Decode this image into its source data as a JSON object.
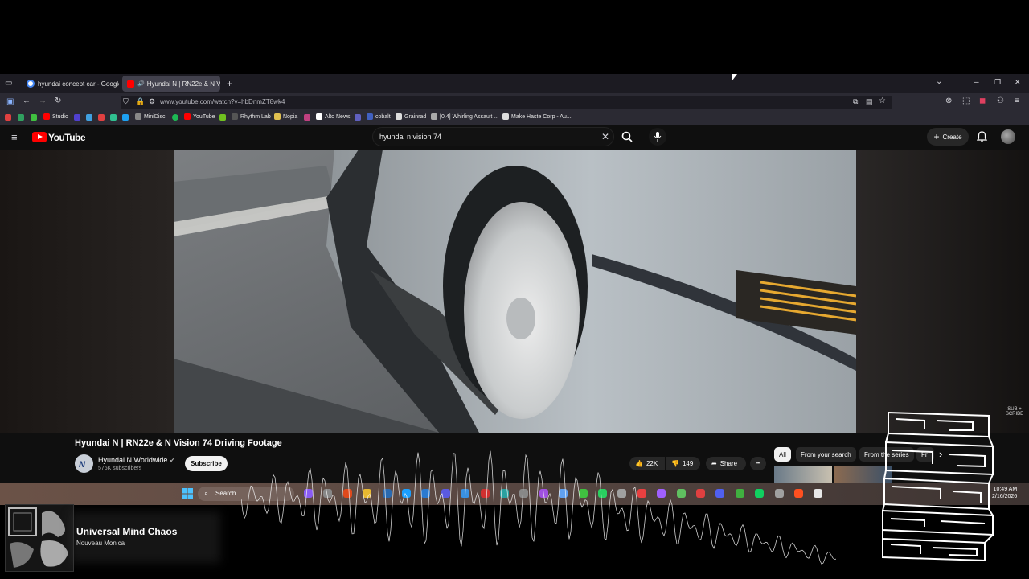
{
  "browser": {
    "tabs": [
      {
        "title": "hyundai concept car - Google S",
        "favicon_color": "#4285f4",
        "active": false
      },
      {
        "title": "Hyundai N | RN22e & N Vi",
        "favicon_color": "#ff0000",
        "active": true
      }
    ],
    "url": "www.youtube.com/watch?v=hbDnmZT8wk4",
    "bookmarks": [
      {
        "label": "Studio",
        "color": "#ff0000"
      },
      {
        "label": "MiniDisc",
        "color": "#888888"
      },
      {
        "label": "YouTube",
        "color": "#ff0000"
      },
      {
        "label": "Rhythm Lab",
        "color": "#555555"
      },
      {
        "label": "Nopia",
        "color": "#e0c050"
      },
      {
        "label": "Alto News",
        "color": "#ffffff"
      },
      {
        "label": "cobalt",
        "color": "#4060c0"
      },
      {
        "label": "Grainrad",
        "color": "#dddddd"
      },
      {
        "label": "[0.4] Whirling Assault ...",
        "color": "#aaaaaa"
      },
      {
        "label": "Make Haste Corp - Au...",
        "color": "#dddddd"
      }
    ],
    "icons": {
      "back": "←",
      "forward": "→",
      "reload": "↻",
      "new_tab": "+",
      "tab_list": "⌄",
      "minimize": "–",
      "maximize": "❐",
      "close": "✕",
      "tab_close": "✕"
    }
  },
  "youtube": {
    "logo_text": "YouTube",
    "search_query": "hyundai n vision 74",
    "create_label": "Create",
    "video_title": "Hyundai N | RN22e & N Vision 74 Driving Footage",
    "channel_name": "Hyundai N Worldwide",
    "subscribers": "576K subscribers",
    "subscribe_label": "Subscribe",
    "likes": "22K",
    "dislikes": "149",
    "share_label": "Share",
    "more_label": "•••",
    "chips": [
      "All",
      "From your search",
      "From the series",
      "Fr"
    ],
    "chip_next": "›",
    "subscribe_watermark": "SUB + SCRIBE"
  },
  "taskbar": {
    "search_label": "Search",
    "time": "10:49 AM",
    "date": "2/16/2026",
    "icon_colors": [
      "#8a5cf5",
      "#888",
      "#e04a1c",
      "#e8b830",
      "#2a6ab0",
      "#1a9fff",
      "#2a7ad0",
      "#5a5ae0",
      "#3a90e0",
      "#d03030",
      "#2aa0a0",
      "#888",
      "#a050e0",
      "#60a0f0",
      "#40c040",
      "#2ad060",
      "#a0a0a0",
      "#e84040",
      "#a060ff",
      "#60c060",
      "#e04040",
      "#5060f0",
      "#40b040",
      "#10d060",
      "#a0a0a0",
      "#ff5020",
      "#e8e8e8"
    ]
  },
  "now_playing": {
    "title": "Universal Mind Chaos",
    "artist": "Nouveau Monica"
  }
}
